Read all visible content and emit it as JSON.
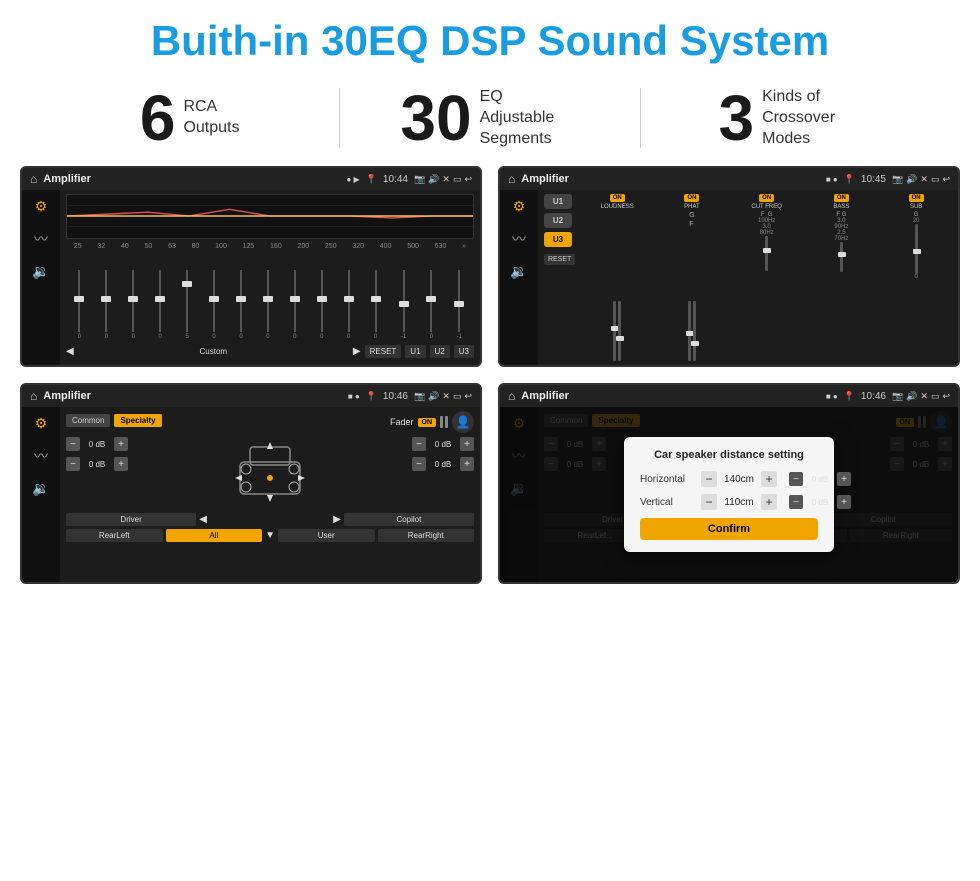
{
  "header": {
    "title": "Buith-in 30EQ DSP Sound System"
  },
  "stats": [
    {
      "number": "6",
      "label": "RCA\nOutputs"
    },
    {
      "number": "30",
      "label": "EQ Adjustable\nSegments"
    },
    {
      "number": "3",
      "label": "Kinds of\nCrossover Modes"
    }
  ],
  "screens": [
    {
      "id": "eq-screen",
      "statusBar": {
        "appName": "Amplifier",
        "time": "10:44"
      },
      "type": "equalizer"
    },
    {
      "id": "crossover-screen",
      "statusBar": {
        "appName": "Amplifier",
        "time": "10:45"
      },
      "type": "crossover"
    },
    {
      "id": "fader-screen",
      "statusBar": {
        "appName": "Amplifier",
        "time": "10:46"
      },
      "type": "fader"
    },
    {
      "id": "dialog-screen",
      "statusBar": {
        "appName": "Amplifier",
        "time": "10:46"
      },
      "type": "dialog",
      "dialog": {
        "title": "Car speaker distance setting",
        "horizontal": {
          "label": "Horizontal",
          "value": "140cm"
        },
        "vertical": {
          "label": "Vertical",
          "value": "110cm"
        },
        "confirmLabel": "Confirm"
      }
    }
  ],
  "eq": {
    "frequencies": [
      "25",
      "32",
      "40",
      "50",
      "63",
      "80",
      "100",
      "125",
      "160",
      "200",
      "250",
      "320",
      "400",
      "500",
      "630"
    ],
    "values": [
      "0",
      "0",
      "0",
      "0",
      "5",
      "0",
      "0",
      "0",
      "0",
      "0",
      "0",
      "0",
      "-1",
      "0",
      "-1"
    ],
    "presetName": "Custom",
    "buttons": [
      "RESET",
      "U1",
      "U2",
      "U3"
    ]
  },
  "crossover": {
    "presets": [
      "U1",
      "U2",
      "U3"
    ],
    "channels": [
      {
        "label": "LOUDNESS",
        "on": true
      },
      {
        "label": "PHAT",
        "on": true
      },
      {
        "label": "CUT FREQ",
        "on": true
      },
      {
        "label": "BASS",
        "on": true
      },
      {
        "label": "SUB",
        "on": true
      }
    ],
    "resetLabel": "RESET"
  },
  "fader": {
    "tabs": [
      "Common",
      "Specialty"
    ],
    "faderLabel": "Fader",
    "onLabel": "ON",
    "dbValues": [
      "0 dB",
      "0 dB",
      "0 dB",
      "0 dB"
    ],
    "bottomButtons": [
      "Driver",
      "RearLeft",
      "All",
      "User",
      "Copilot",
      "RearRight"
    ]
  },
  "dialog": {
    "title": "Car speaker distance setting",
    "horizontalLabel": "Horizontal",
    "horizontalValue": "140cm",
    "verticalLabel": "Vertical",
    "verticalValue": "110cm",
    "confirmLabel": "Confirm",
    "dbValues": [
      "0 dB",
      "0 dB"
    ]
  }
}
